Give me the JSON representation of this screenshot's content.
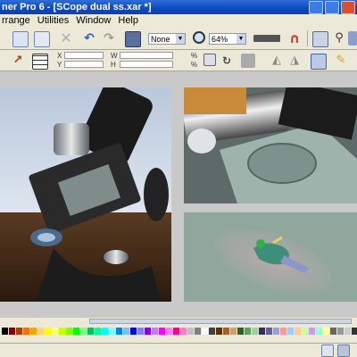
{
  "window": {
    "title": "ner Pro 6 - [SCope dual ss.xar *]"
  },
  "menu": [
    "rrange",
    "Utilities",
    "Window",
    "Help"
  ],
  "toolbar": {
    "quality_value": "None",
    "zoom_value": "64%"
  },
  "infobar": {
    "x_label": "X",
    "y_label": "Y",
    "w_label": "W",
    "h_label": "H",
    "pct_label": "%"
  },
  "colors": {
    "title_bar": "#0a49c2",
    "chrome": "#ece9d8"
  },
  "palette": [
    "#000000",
    "#7f0000",
    "#b33b00",
    "#ff6a00",
    "#ffa500",
    "#ffd27f",
    "#ffff00",
    "#ffff7f",
    "#c8ff00",
    "#80ff00",
    "#00ff00",
    "#7fff7f",
    "#00c060",
    "#00ff99",
    "#00ffff",
    "#7fffff",
    "#0080ff",
    "#7fbfff",
    "#0000ff",
    "#7f7fff",
    "#8000ff",
    "#bf7fff",
    "#ff00ff",
    "#ff7fff",
    "#ff0080",
    "#ff7fbf",
    "#c0c0c0",
    "#808080",
    "#ffffff",
    "#404040",
    "#603000",
    "#a06030",
    "#d0a070",
    "#306030",
    "#60a060",
    "#a0d0a0",
    "#303060",
    "#6060a0",
    "#a0a0d0",
    "#ff9999",
    "#99ccff",
    "#ffcc99",
    "#ccff99",
    "#cc99ff",
    "#99ffcc",
    "#ffff99",
    "#666666",
    "#999999",
    "#cccccc",
    "#333333"
  ]
}
